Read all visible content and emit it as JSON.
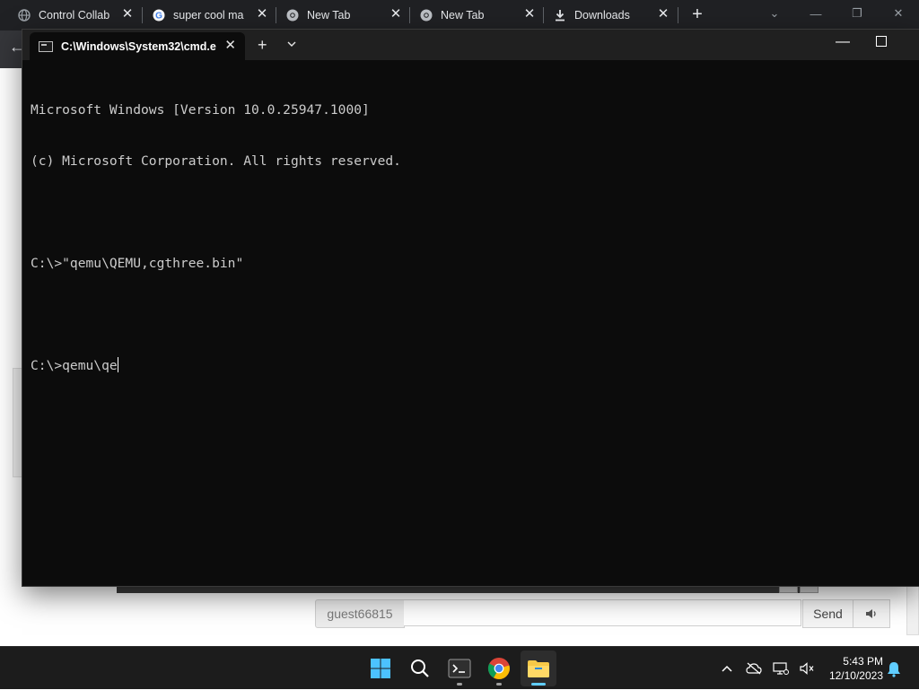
{
  "chrome": {
    "tabs": [
      {
        "title": "Control Collab",
        "icon": "globe-icon"
      },
      {
        "title": "super cool ma",
        "icon": "google-icon"
      },
      {
        "title": "New Tab",
        "icon": "chrome-icon"
      },
      {
        "title": "New Tab",
        "icon": "chrome-icon"
      },
      {
        "title": "Downloads",
        "icon": "download-icon"
      }
    ],
    "new_tab": "+",
    "back": "←"
  },
  "page": {
    "chat": {
      "username": "guest66815",
      "input_value": "",
      "send_label": "Send"
    }
  },
  "terminal": {
    "tab_title": "C:\\Windows\\System32\\cmd.e",
    "new_tab": "+",
    "console_lines": [
      "Microsoft Windows [Version 10.0.25947.1000]",
      "(c) Microsoft Corporation. All rights reserved.",
      "",
      "C:\\>\"qemu\\QEMU,cgthree.bin\"",
      "",
      "C:\\>qemu\\qe"
    ]
  },
  "taskbar": {
    "apps": [
      "windows-start",
      "search",
      "terminal",
      "chrome",
      "file-explorer"
    ],
    "time": "5:43 PM",
    "date": "12/10/2023"
  },
  "colors": {
    "terminal_bg": "#0c0c0c",
    "titlebar_bg": "#202020",
    "console_text": "#cccccc",
    "taskbar_bg": "#1c1c1c",
    "accent": "#60cdff"
  }
}
